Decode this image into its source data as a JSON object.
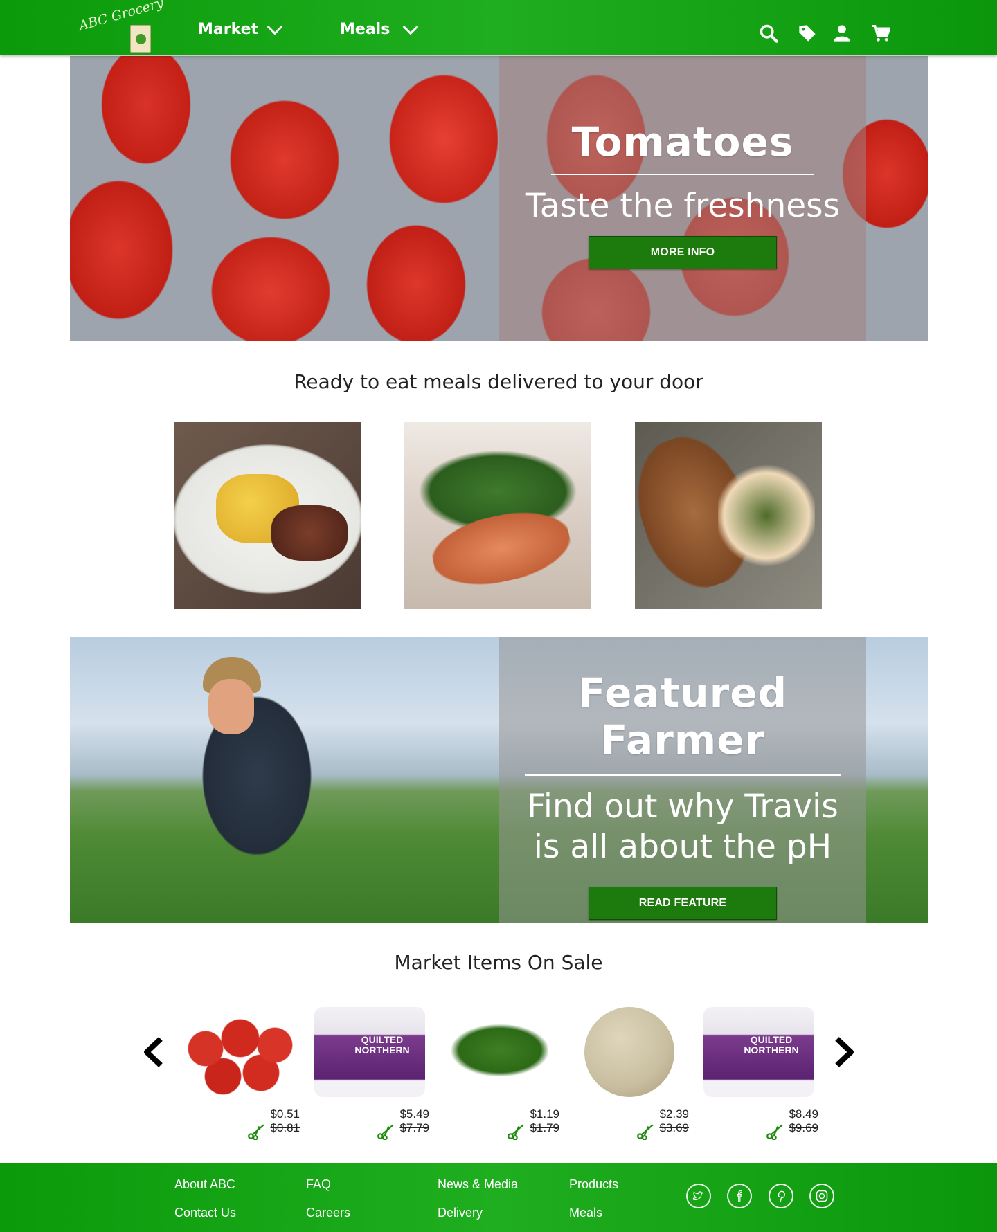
{
  "header": {
    "logo_text": "ABC Grocery",
    "nav": [
      {
        "label": "Market"
      },
      {
        "label": "Meals"
      }
    ],
    "icons": [
      "search-icon",
      "tag-icon",
      "user-icon",
      "cart-icon"
    ]
  },
  "hero": {
    "title": "Tomatoes",
    "subtitle": "Taste the freshness",
    "button": "MORE INFO"
  },
  "meals": {
    "heading": "Ready to eat meals delivered to your door"
  },
  "featured": {
    "title": "Featured Farmer",
    "subtitle_line1": "Find out why Travis",
    "subtitle_line2": "is all about the pH",
    "button": "READ FEATURE"
  },
  "sale": {
    "heading": "Market Items On Sale",
    "items": [
      {
        "name": "tomatoes",
        "price": "$0.51",
        "old_price": "$0.81"
      },
      {
        "name": "quilted-northern",
        "price": "$5.49",
        "old_price": "$7.79"
      },
      {
        "name": "herbs",
        "price": "$1.19",
        "old_price": "$1.79"
      },
      {
        "name": "melon",
        "price": "$2.39",
        "old_price": "$3.69"
      },
      {
        "name": "quilted-northern",
        "price": "$8.49",
        "old_price": "$9.69"
      }
    ]
  },
  "footer": {
    "links": [
      {
        "label": "About ABC"
      },
      {
        "label": "Contact Us"
      },
      {
        "label": "FAQ"
      },
      {
        "label": "Careers"
      },
      {
        "label": "News & Media"
      },
      {
        "label": "Delivery"
      },
      {
        "label": "Products"
      },
      {
        "label": "Meals"
      }
    ],
    "social": [
      "twitter-icon",
      "facebook-icon",
      "pinterest-icon",
      "instagram-icon"
    ]
  },
  "colors": {
    "brand_green": "#1fae1f",
    "button_green": "#1d7a0c",
    "sale_scissors": "#1d8a0c"
  }
}
